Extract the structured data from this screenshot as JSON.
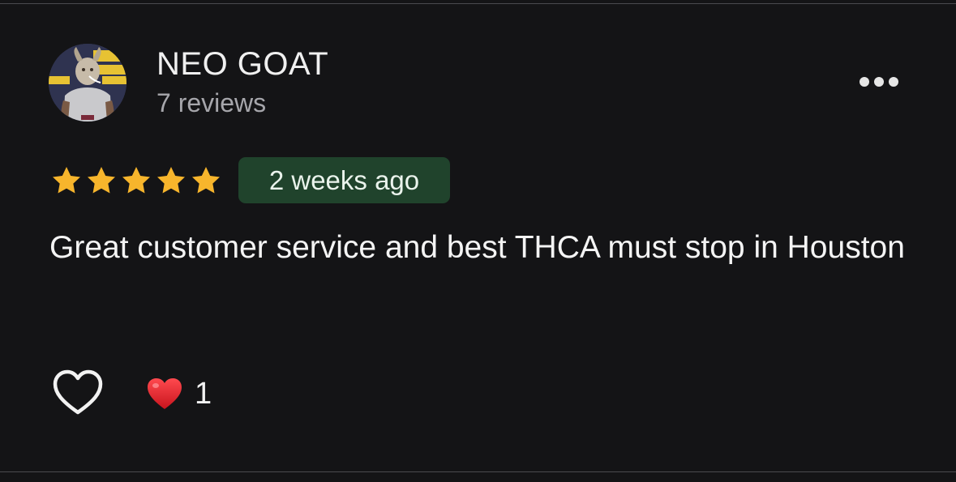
{
  "review": {
    "reviewer_name": "NEO GOAT",
    "review_count": "7 reviews",
    "rating": 5,
    "rating_max": 5,
    "time_ago": "2 weeks ago",
    "text": "Great customer service and best THCA must stop in Houston"
  },
  "reactions": {
    "like_icon": "heart-outline-icon",
    "emoji_icon": "red-heart-icon",
    "count": "1"
  },
  "icons": {
    "more": "more-horizontal-icon",
    "star": "star-filled-icon"
  },
  "colors": {
    "background": "#141416",
    "star": "#F7B52C",
    "badge_background": "#20432C",
    "secondary_text": "#A6A6AB",
    "heart_red": "#E0222B"
  }
}
